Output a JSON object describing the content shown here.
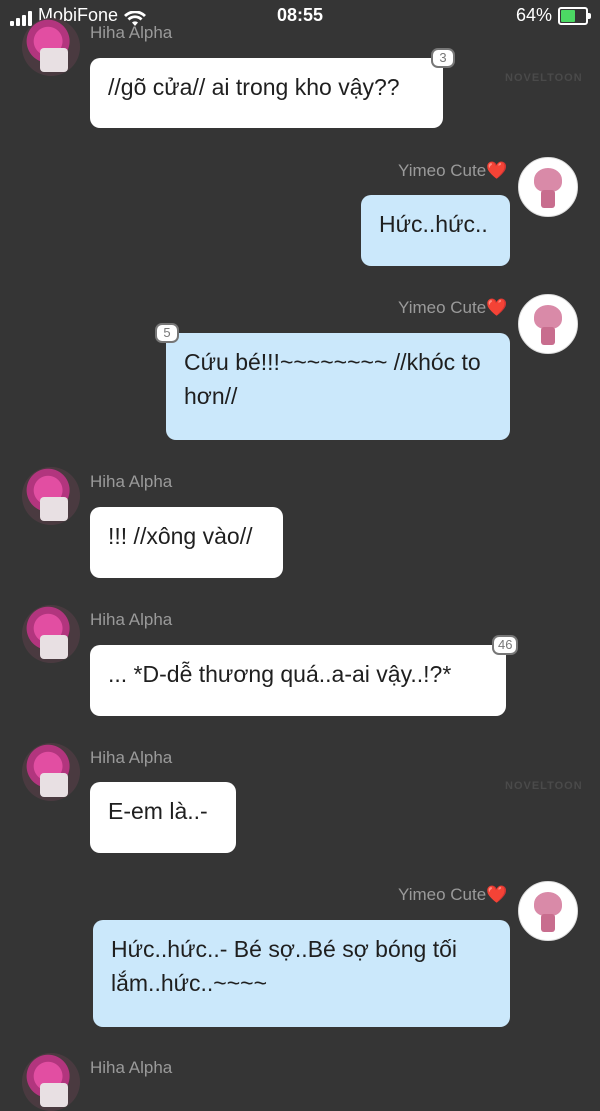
{
  "status_bar": {
    "carrier": "MobiFone",
    "time": "08:55",
    "battery": "64%",
    "battery_level": 0.64
  },
  "watermark": "NOVELTOON",
  "messages": [
    {
      "sender": "Hiha Alpha",
      "text": "//gõ cửa// ai trong kho vậy??",
      "badge": "3"
    },
    {
      "sender": "Yimeo Cute",
      "heart": "❤️",
      "text": "Hức..hức.."
    },
    {
      "sender": "Yimeo Cute",
      "heart": "❤️",
      "text": "Cứu bé!!!~~~~~~~~ //khóc to hơn//",
      "badge": "5"
    },
    {
      "sender": "Hiha Alpha",
      "text": "!!! //xông vào//"
    },
    {
      "sender": "Hiha Alpha",
      "text": "... *D-dễ thương quá..a-ai vậy..!?*",
      "badge": "46"
    },
    {
      "sender": "Hiha Alpha",
      "text": "E-em là..-"
    },
    {
      "sender": "Yimeo Cute",
      "heart": "❤️",
      "text": "Hức..hức..- Bé sợ..Bé sợ bóng tối lắm..hức..~~~~"
    },
    {
      "sender": "Hiha Alpha"
    }
  ]
}
